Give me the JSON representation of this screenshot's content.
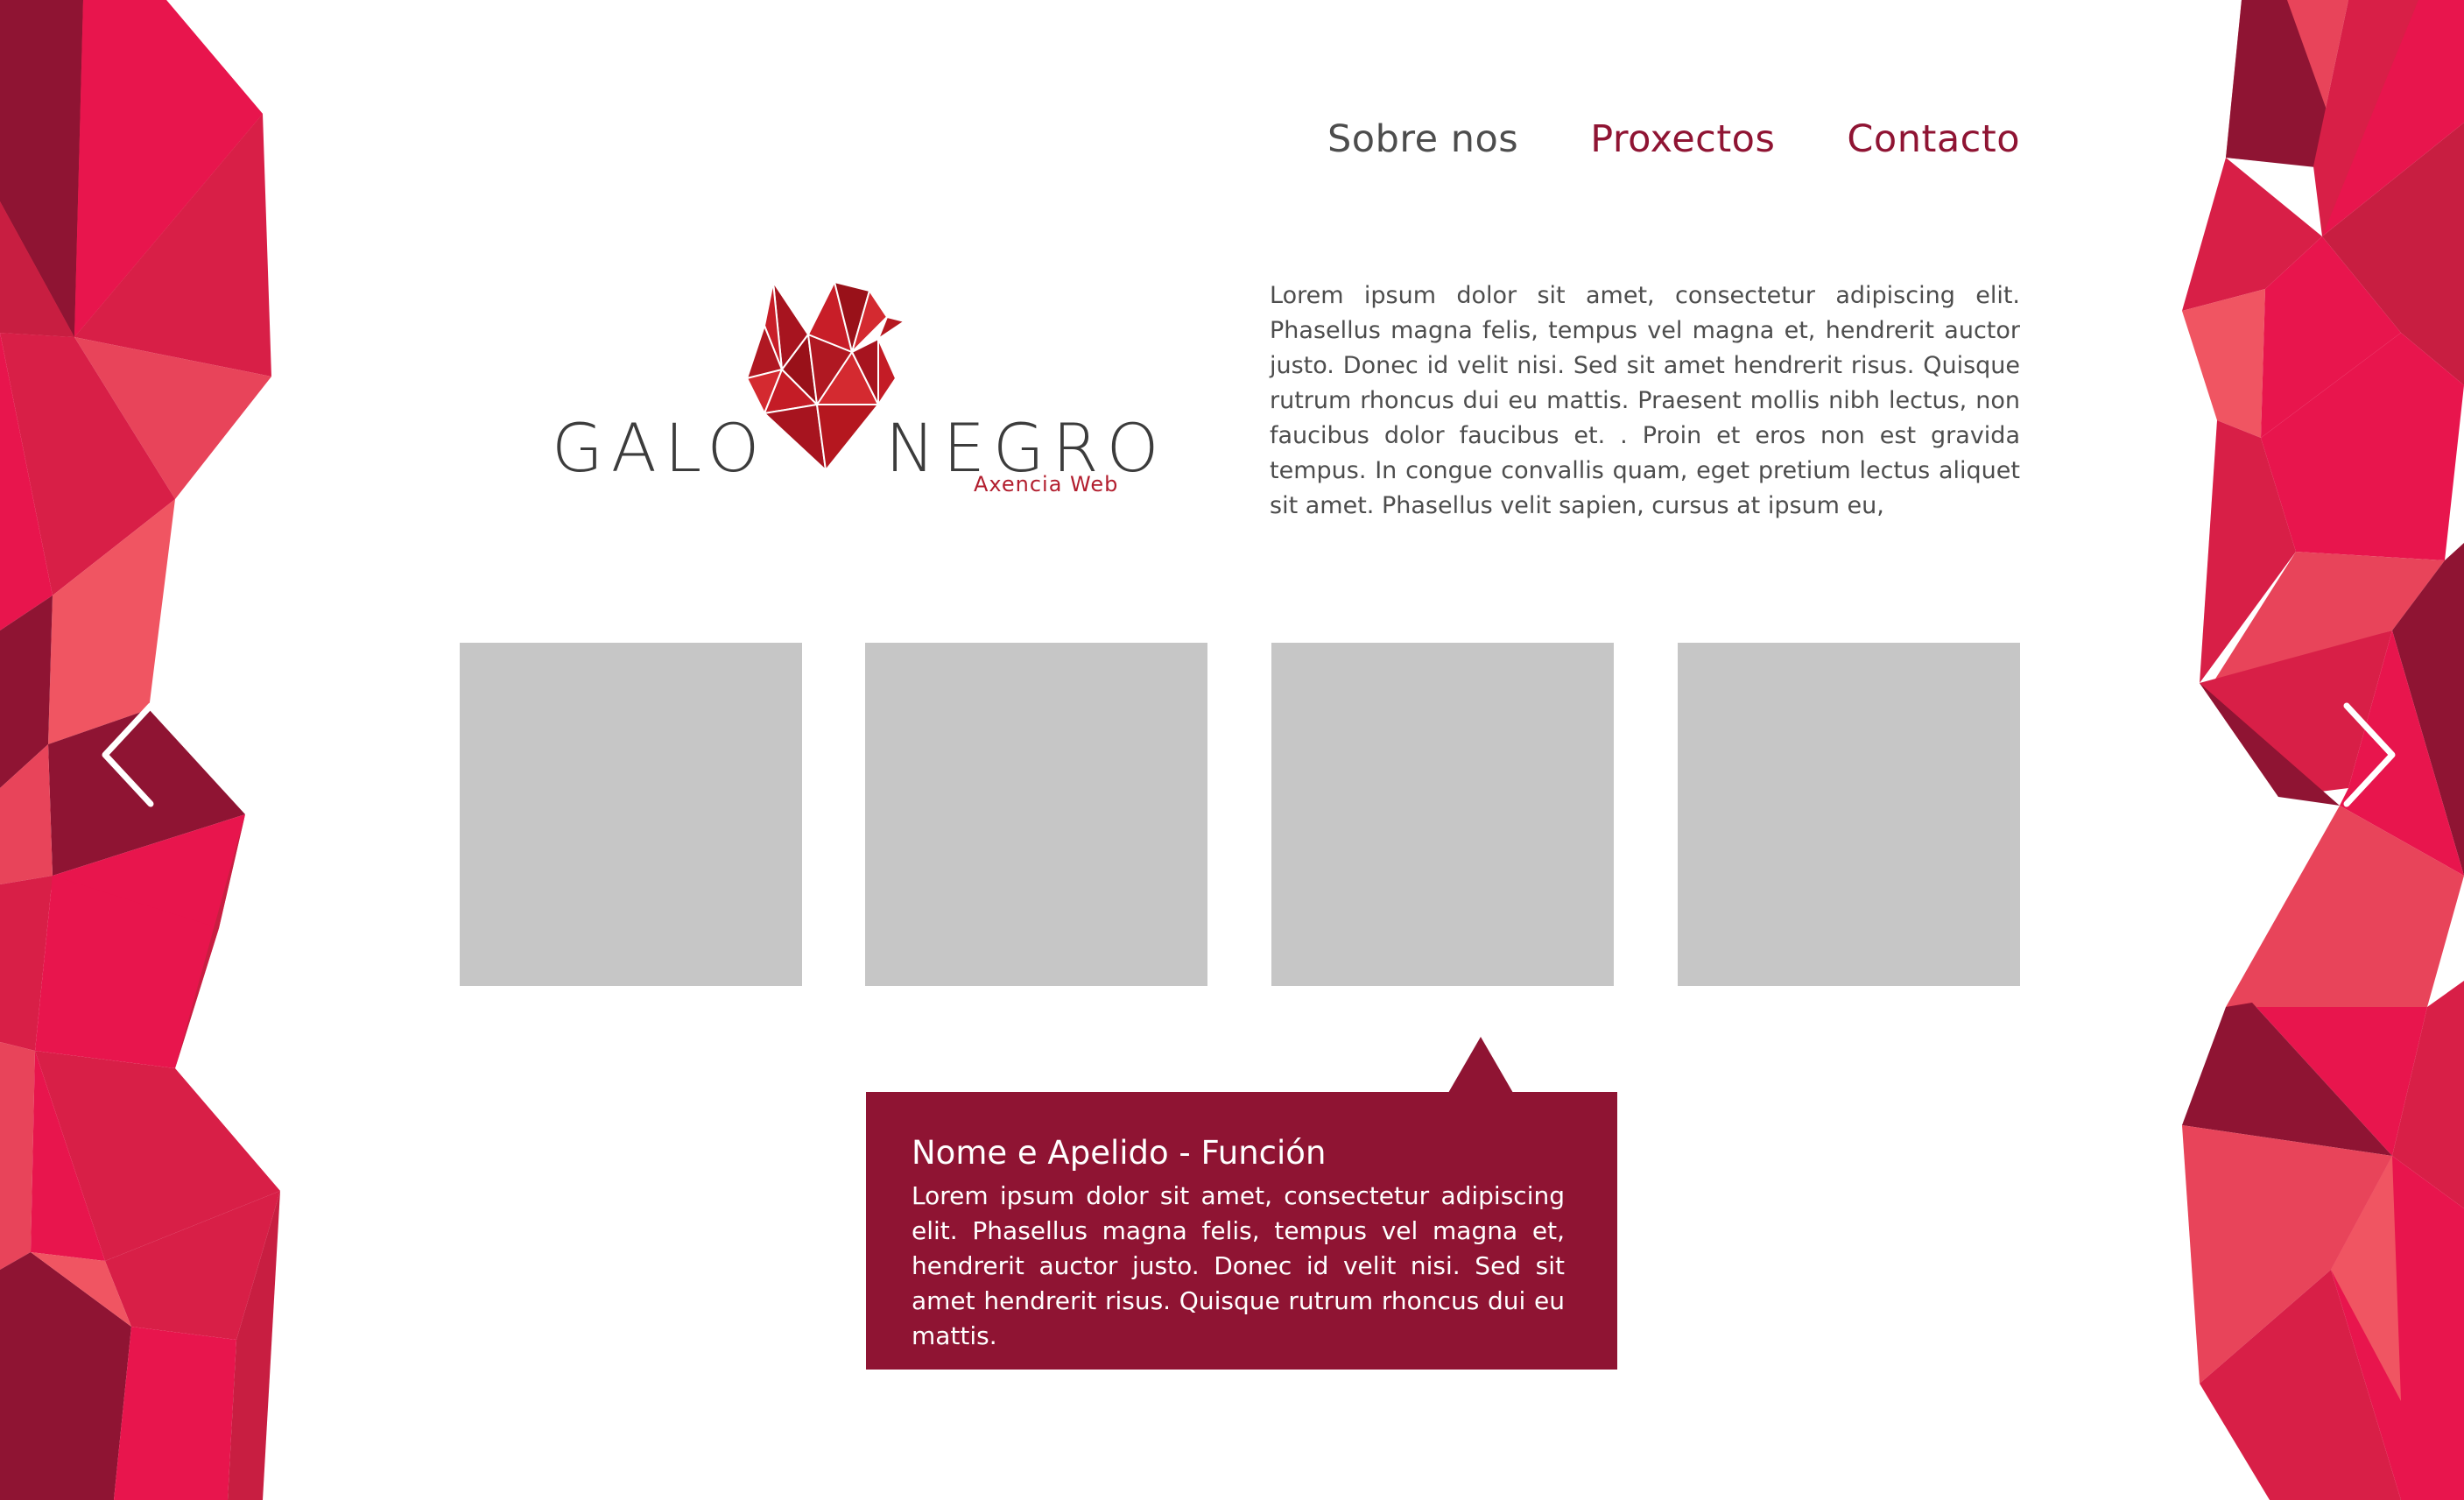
{
  "nav": {
    "items": [
      {
        "label": "Sobre nos"
      },
      {
        "label": "Proxectos"
      },
      {
        "label": "Contacto"
      }
    ]
  },
  "logo": {
    "word_left": "GALO",
    "word_right": "NEGRO",
    "tagline": "Axencia Web"
  },
  "intro": {
    "text": "Lorem ipsum dolor sit amet, consectetur adipiscing elit. Phasellus magna felis, tempus vel magna et, hendrerit auctor justo. Donec id velit nisi. Sed sit amet hendrerit risus. Quisque rutrum rhoncus dui eu mattis. Praesent mollis nibh lectus, non faucibus dolor faucibus et. . Proin et eros non est gravida tempus. In congue convallis quam, eget pretium lectus aliquet sit amet. Phasellus velit sapien, cursus at ipsum eu,"
  },
  "carousel": {
    "tile_count": 4,
    "prev_icon": "chevron-left-icon",
    "next_icon": "chevron-right-icon"
  },
  "caption": {
    "title": "Nome e Apelido - Función",
    "text": "Lorem ipsum dolor sit amet, consectetur adipiscing elit. Phasellus magna felis, tempus vel magna et, hendrerit auctor justo. Donec id velit nisi. Sed sit amet hendrerit risus. Quisque rutrum rhoncus dui eu mattis."
  },
  "colors": {
    "brand": "#8f1433",
    "text": "#4d4d4d",
    "tile": "#c6c6c6",
    "poly_palette": [
      "#e8445a",
      "#d81f47",
      "#8f1433",
      "#e8154d",
      "#f05562",
      "#c81e41"
    ]
  }
}
